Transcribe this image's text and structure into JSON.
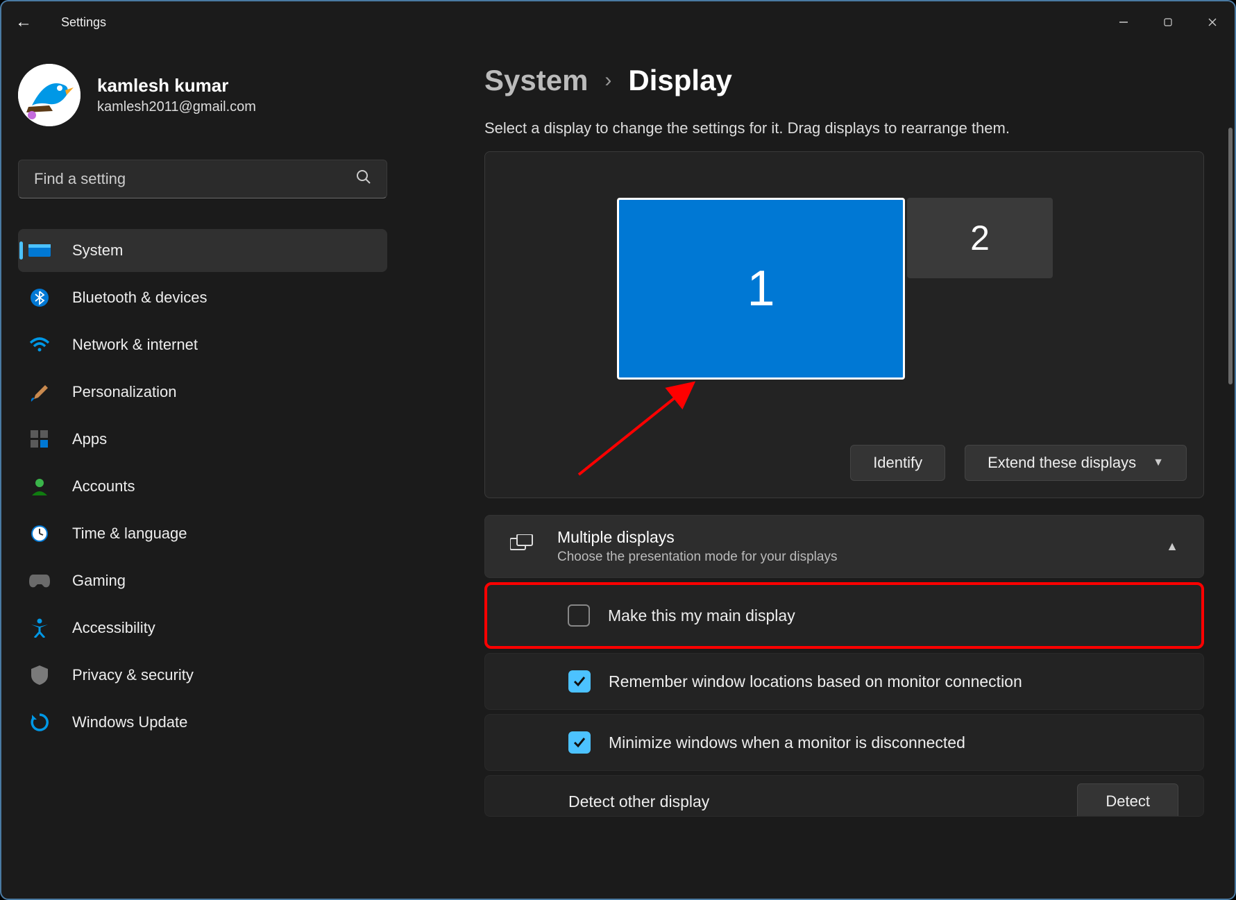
{
  "titlebar": {
    "app_title": "Settings"
  },
  "profile": {
    "name": "kamlesh kumar",
    "email": "kamlesh2011@gmail.com"
  },
  "search": {
    "placeholder": "Find a setting"
  },
  "nav": {
    "items": [
      {
        "label": "System"
      },
      {
        "label": "Bluetooth & devices"
      },
      {
        "label": "Network & internet"
      },
      {
        "label": "Personalization"
      },
      {
        "label": "Apps"
      },
      {
        "label": "Accounts"
      },
      {
        "label": "Time & language"
      },
      {
        "label": "Gaming"
      },
      {
        "label": "Accessibility"
      },
      {
        "label": "Privacy & security"
      },
      {
        "label": "Windows Update"
      }
    ]
  },
  "breadcrumb": {
    "parent": "System",
    "current": "Display"
  },
  "main": {
    "subtitle": "Select a display to change the settings for it. Drag displays to rearrange them.",
    "monitors": {
      "m1": "1",
      "m2": "2"
    },
    "identify_label": "Identify",
    "extend_label": "Extend these displays",
    "multiple_displays": {
      "title": "Multiple displays",
      "desc": "Choose the presentation mode for your displays"
    },
    "settings": {
      "main_display": "Make this my main display",
      "remember": "Remember window locations based on monitor connection",
      "minimize": "Minimize windows when a monitor is disconnected",
      "detect_label": "Detect other display",
      "detect_btn": "Detect"
    }
  }
}
